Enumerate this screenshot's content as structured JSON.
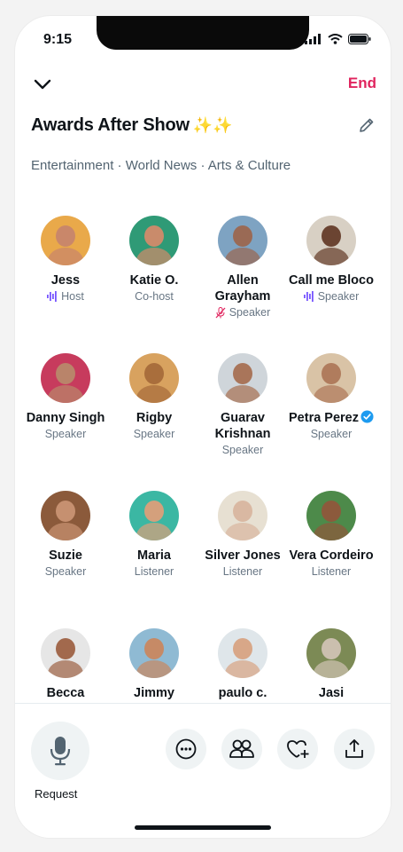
{
  "status": {
    "time": "9:15"
  },
  "header": {
    "end_label": "End"
  },
  "space": {
    "title": "Awards After Show",
    "sparkles": "✨✨",
    "topics": "Entertainment · World News · Arts & Culture"
  },
  "participants": [
    {
      "name": "Jess",
      "role": "Host",
      "role_icon": "sound-wave-icon",
      "avatar": "#e9a94a",
      "skin": "#c9876a"
    },
    {
      "name": "Katie O.",
      "role": "Co-host",
      "role_icon": "",
      "avatar": "#2f9a76",
      "skin": "#c98b6b"
    },
    {
      "name": "Allen Grayham",
      "role": "Speaker",
      "role_icon": "mic-muted-icon",
      "avatar": "#7ea3c2",
      "skin": "#9a6a55"
    },
    {
      "name": "Call me Bloco",
      "role": "Speaker",
      "role_icon": "sound-wave-icon",
      "avatar": "#d8d0c4",
      "skin": "#6b4432"
    },
    {
      "name": "Danny Singh",
      "role": "Speaker",
      "role_icon": "",
      "avatar": "#c73b5d",
      "skin": "#b9846a"
    },
    {
      "name": "Rigby",
      "role": "Speaker",
      "role_icon": "",
      "avatar": "#d8a25f",
      "skin": "#a96e3c"
    },
    {
      "name": "Guarav Krishnan",
      "role": "Speaker",
      "role_icon": "",
      "avatar": "#cfd5da",
      "skin": "#a9755a"
    },
    {
      "name": "Petra Perez",
      "role": "Speaker",
      "role_icon": "",
      "avatar": "#d9c3a6",
      "skin": "#b07c5d",
      "verified": true
    },
    {
      "name": "Suzie",
      "role": "Speaker",
      "role_icon": "",
      "avatar": "#8b5a3b",
      "skin": "#c69070"
    },
    {
      "name": "Maria",
      "role": "Listener",
      "role_icon": "",
      "avatar": "#3bb7a3",
      "skin": "#d4a07c"
    },
    {
      "name": "Silver Jones",
      "role": "Listener",
      "role_icon": "",
      "avatar": "#e7e0d2",
      "skin": "#d9b8a2"
    },
    {
      "name": "Vera Cordeiro",
      "role": "Listener",
      "role_icon": "",
      "avatar": "#4d8a4a",
      "skin": "#8c5a3c"
    },
    {
      "name": "Becca",
      "role": "",
      "role_icon": "",
      "avatar": "#e6e6e6",
      "skin": "#a2694d"
    },
    {
      "name": "Jimmy",
      "role": "",
      "role_icon": "",
      "avatar": "#8fbad3",
      "skin": "#c68a66"
    },
    {
      "name": "paulo c.",
      "role": "",
      "role_icon": "",
      "avatar": "#dfe6ea",
      "skin": "#d8a788"
    },
    {
      "name": "Jasi",
      "role": "",
      "role_icon": "",
      "avatar": "#7c8a55",
      "skin": "#cbbfae"
    }
  ],
  "footer": {
    "request_label": "Request",
    "actions": [
      "more-icon",
      "people-icon",
      "heart-plus-icon",
      "share-icon"
    ]
  },
  "colors": {
    "accent_end": "#e0245e",
    "wave": "#7856ff",
    "muted": "#e0245e",
    "verified": "#1d9bf0"
  }
}
